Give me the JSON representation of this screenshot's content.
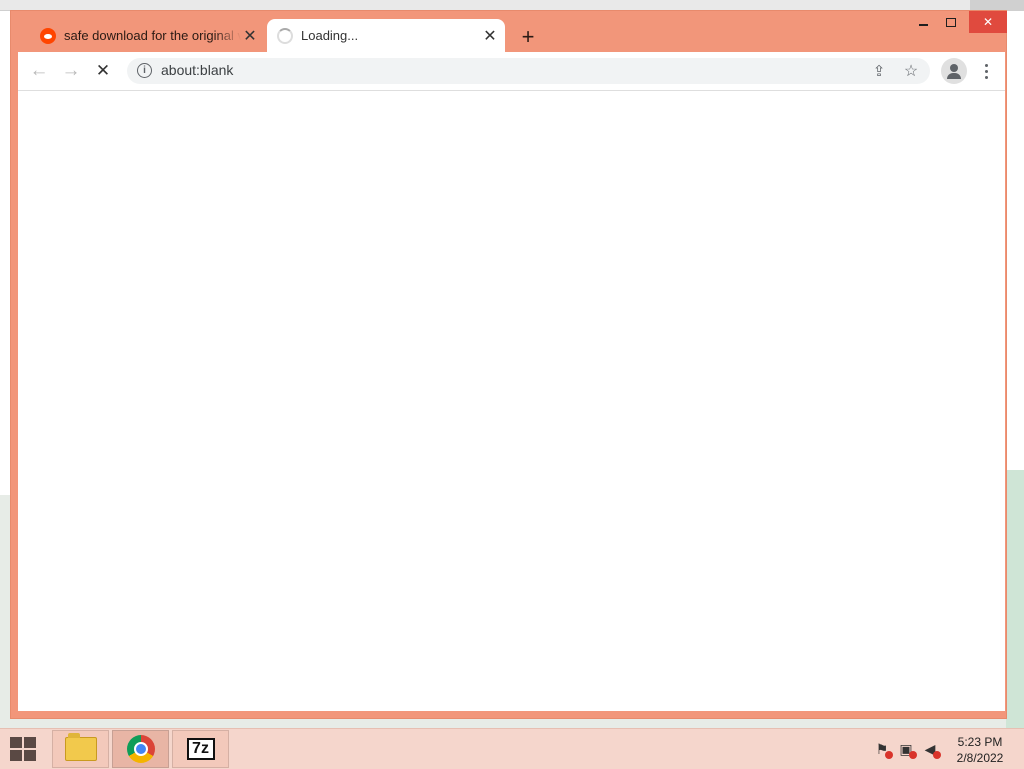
{
  "browser": {
    "tabs": [
      {
        "title": "safe download for the original ve",
        "favicon": "reddit-icon",
        "active": false
      },
      {
        "title": "Loading...",
        "favicon": "loading-spinner",
        "active": true
      }
    ],
    "new_tab_label": "+",
    "close_glyph": "✕",
    "address": {
      "url": "about:blank"
    },
    "frame_color": "#f2967a"
  },
  "taskbar": {
    "apps": [
      {
        "name": "File Explorer",
        "icon": "folder-icon"
      },
      {
        "name": "Google Chrome",
        "icon": "chrome-icon",
        "active": true
      },
      {
        "name": "7-Zip",
        "icon": "7z-icon",
        "label": "7z"
      }
    ],
    "clock": {
      "time": "5:23 PM",
      "date": "2/8/2022"
    }
  }
}
